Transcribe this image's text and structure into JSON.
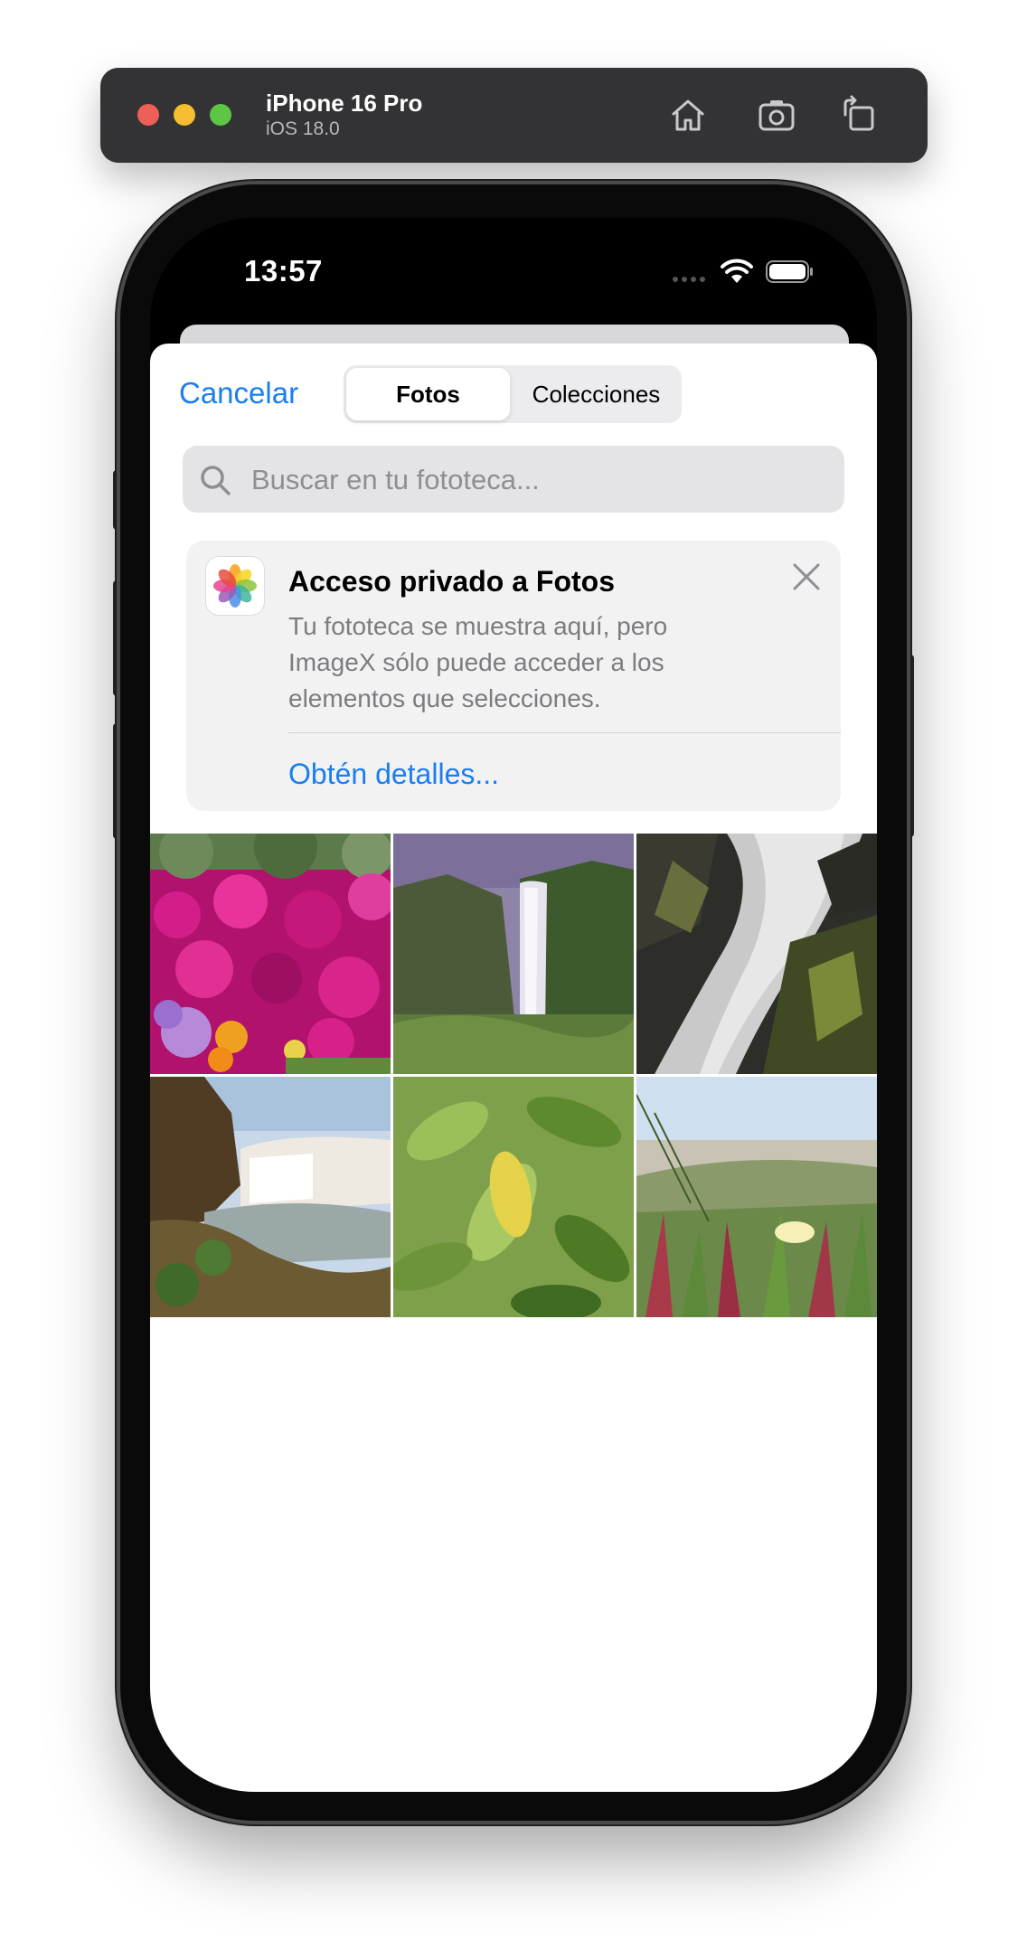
{
  "simulator": {
    "device_name": "iPhone 16 Pro",
    "os_version": "iOS 18.0",
    "buttons": [
      "home-icon",
      "screenshot-icon",
      "rotate-icon"
    ]
  },
  "status_bar": {
    "time": "13:57"
  },
  "picker": {
    "cancel_label": "Cancelar",
    "tabs": [
      {
        "label": "Fotos",
        "selected": true
      },
      {
        "label": "Colecciones",
        "selected": false
      }
    ],
    "search": {
      "placeholder": "Buscar en tu fototeca..."
    },
    "banner": {
      "title": "Acceso privado a Fotos",
      "body": "Tu fototeca se muestra aquí, pero ImageX sólo puede acceder a los elementos que selecciones.",
      "link": "Obtén detalles..."
    },
    "photos": [
      {
        "subject": "magenta-flowers"
      },
      {
        "subject": "waterfall-cliff"
      },
      {
        "subject": "waterfall-rocks"
      },
      {
        "subject": "waterfall-river"
      },
      {
        "subject": "green-leaves"
      },
      {
        "subject": "dune-flower"
      }
    ]
  },
  "colors": {
    "accent": "#1a7ef0",
    "sheet": "#ffffff",
    "banner_bg": "#f2f2f3",
    "search_bg": "#e4e4e6"
  }
}
